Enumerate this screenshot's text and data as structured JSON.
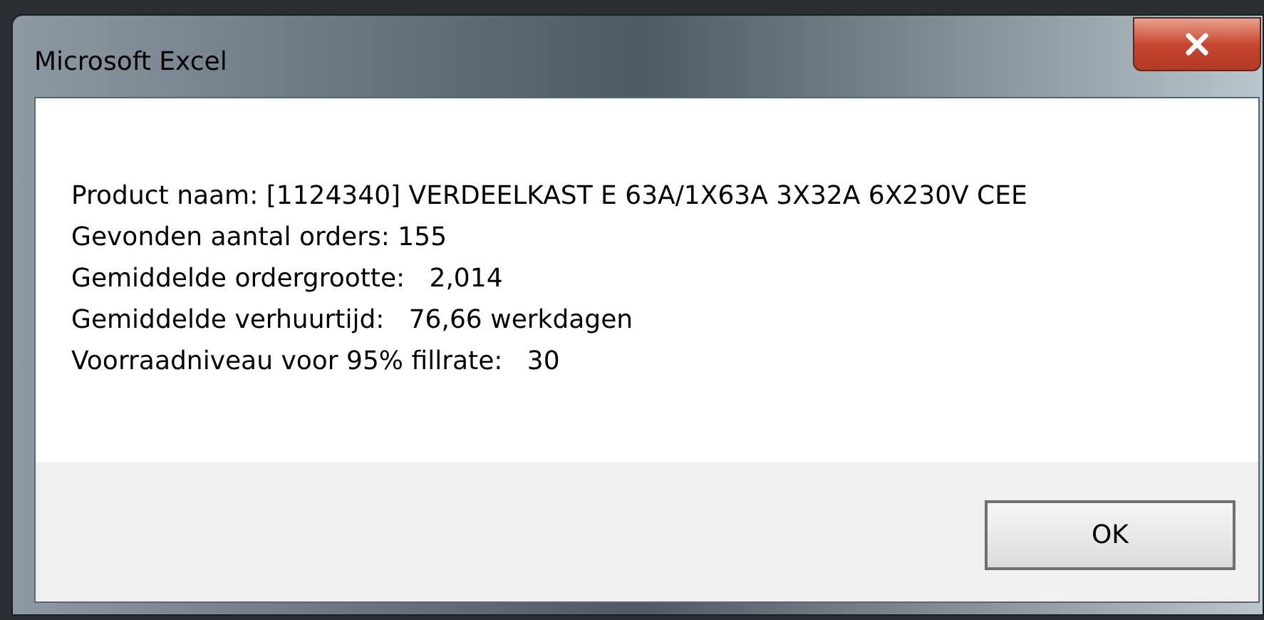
{
  "window": {
    "title": "Microsoft Excel"
  },
  "message": [
    "Product naam: [1124340] VERDEELKAST E 63A/1X63A 3X32A 6X230V CEE",
    "Gevonden aantal orders: 155",
    "Gemiddelde ordergrootte:   2,014",
    "Gemiddelde verhuurtijd:   76,66 werkdagen",
    "Voorraadniveau voor 95% fillrate:   30"
  ],
  "buttons": [
    "OK"
  ]
}
